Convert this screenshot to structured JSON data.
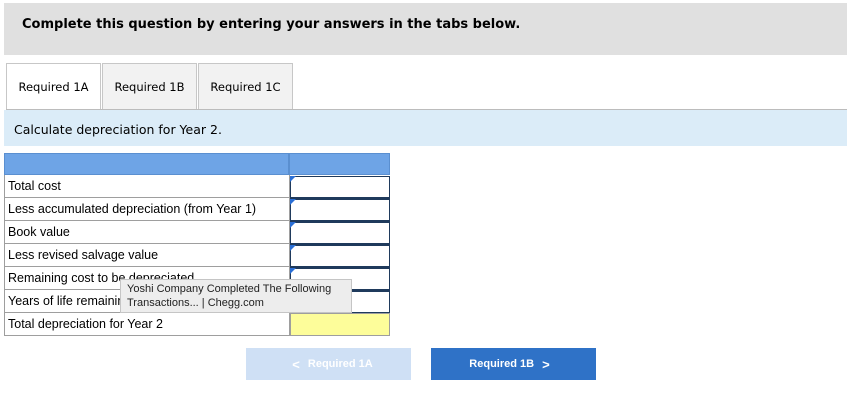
{
  "banner": {
    "text": "Complete this question by entering your answers in the tabs below."
  },
  "tabs": [
    {
      "label": "Required 1A",
      "active": true
    },
    {
      "label": "Required 1B",
      "active": false
    },
    {
      "label": "Required 1C",
      "active": false
    }
  ],
  "instruction": "Calculate depreciation for Year 2.",
  "table": {
    "rows": [
      {
        "label": "Total cost",
        "value": ""
      },
      {
        "label": "Less accumulated depreciation (from Year 1)",
        "value": ""
      },
      {
        "label": "Book value",
        "value": ""
      },
      {
        "label": "Less revised salvage value",
        "value": ""
      },
      {
        "label": "Remaining cost to be depreciated",
        "value": ""
      },
      {
        "label": "Years of life remaining",
        "value": ""
      },
      {
        "label": "Total depreciation for Year 2",
        "value": ""
      }
    ]
  },
  "tooltip": {
    "line1": "Yoshi Company Completed The Following",
    "line2": "Transactions... | Chegg.com"
  },
  "nav": {
    "prev_label": "Required 1A",
    "prev_chevron": "<",
    "next_label": "Required 1B",
    "next_chevron": ">"
  },
  "colors": {
    "header_blue": "#6ea4e6",
    "instruction_bg": "#dbecf8",
    "next_button": "#2f72c7",
    "prev_button_disabled": "#cfe0f5",
    "total_cell": "#fdfd9a"
  }
}
